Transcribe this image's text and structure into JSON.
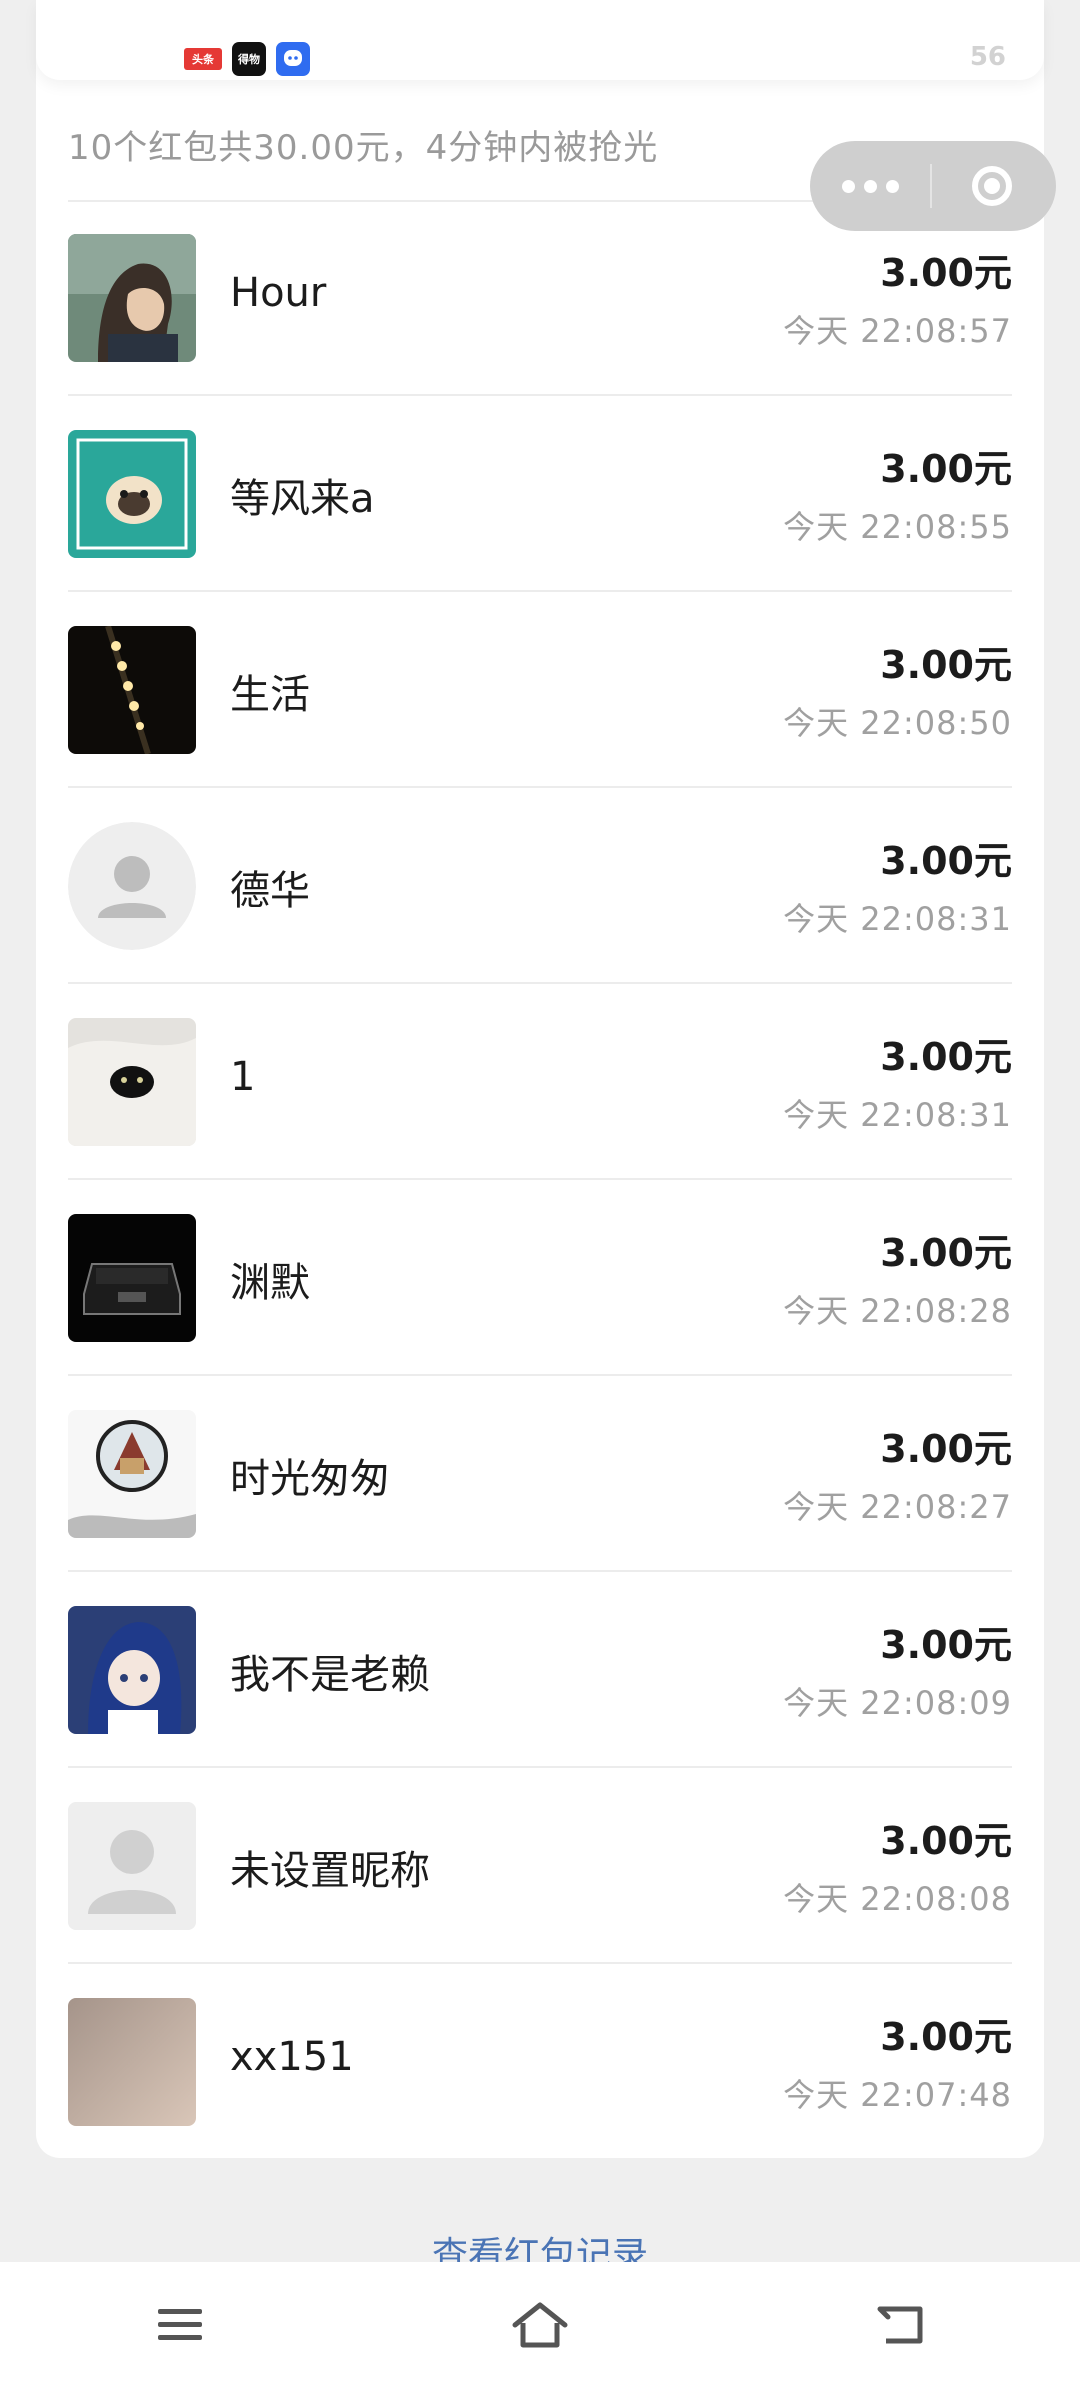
{
  "top_stub": {
    "apps": [
      {
        "label": "头条",
        "color": "#e53935"
      },
      {
        "label": "得物",
        "color": "#111111"
      },
      {
        "label": "",
        "color": "#2f6cf0"
      }
    ],
    "count": "56"
  },
  "summary": "10个红包共30.00元，4分钟内被抢光",
  "capsule": {
    "more_icon": "more-dots-icon",
    "close_icon": "target-circle-icon"
  },
  "records": [
    {
      "name": "Hour",
      "amount": "3.00元",
      "time": "今天 22:08:57"
    },
    {
      "name": "等风来a",
      "amount": "3.00元",
      "time": "今天 22:08:55"
    },
    {
      "name": "生活",
      "amount": "3.00元",
      "time": "今天 22:08:50"
    },
    {
      "name": "德华",
      "amount": "3.00元",
      "time": "今天 22:08:31"
    },
    {
      "name": "1",
      "amount": "3.00元",
      "time": "今天 22:08:31"
    },
    {
      "name": "渊默",
      "amount": "3.00元",
      "time": "今天 22:08:28"
    },
    {
      "name": "时光匆匆",
      "amount": "3.00元",
      "time": "今天 22:08:27"
    },
    {
      "name": "我不是老赖",
      "amount": "3.00元",
      "time": "今天 22:08:09"
    },
    {
      "name": "未设置昵称",
      "amount": "3.00元",
      "time": "今天 22:08:08"
    },
    {
      "name": "xx151",
      "amount": "3.00元",
      "time": "今天 22:07:48"
    }
  ],
  "record_link": "查看红包记录",
  "navbar": {
    "menu_icon": "menu-icon",
    "home_icon": "home-icon",
    "back_icon": "back-icon"
  }
}
